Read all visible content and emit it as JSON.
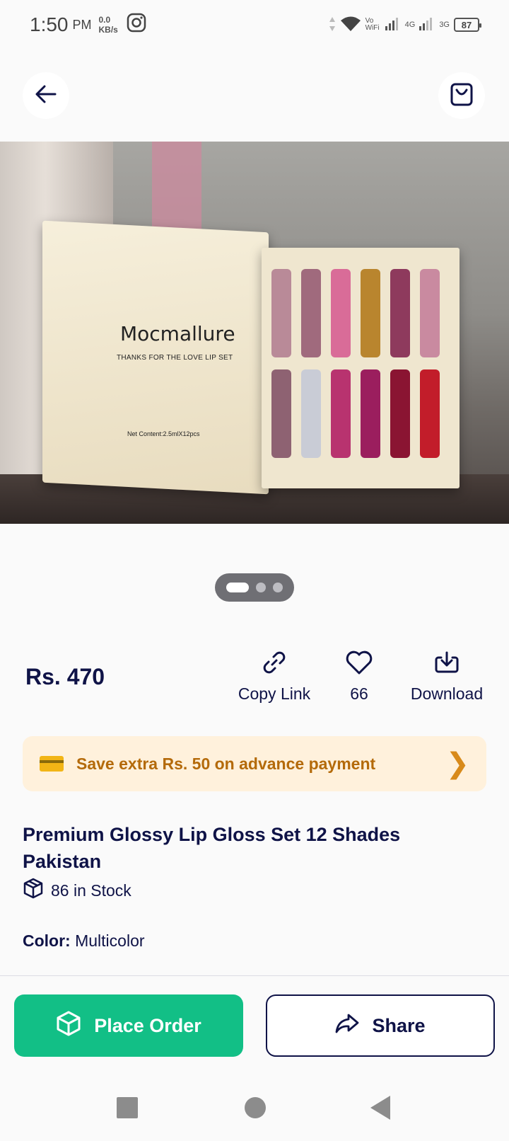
{
  "status_bar": {
    "time": "1:50",
    "ampm": "PM",
    "speed_value": "0.0",
    "speed_unit": "KB/s",
    "vowifi": "Vo WiFi",
    "net1": "4G",
    "net2": "3G",
    "battery": "87"
  },
  "nav": {
    "back_icon": "arrow-left-icon",
    "cart_icon": "shopping-bag-icon"
  },
  "product_image": {
    "brand_text": "Mocmallure",
    "tagline": "THANKS FOR THE LOVE LIP SET",
    "net_content": "Net Content:2.5mlX12pcs",
    "carousel": {
      "total": 3,
      "active_index": 0
    }
  },
  "price": "Rs. 470",
  "actions": {
    "copy_link": "Copy Link",
    "likes": "66",
    "download": "Download"
  },
  "promo": {
    "text": "Save extra Rs. 50 on advance payment",
    "chevron": "❯"
  },
  "product": {
    "title": "Premium Glossy Lip Gloss Set 12 Shades Pakistan",
    "stock": "86 in Stock",
    "color_label": "Color:",
    "color_value": "Multicolor"
  },
  "buttons": {
    "place_order": "Place Order",
    "share": "Share"
  },
  "colors": {
    "primary": "#0f1347",
    "order_green": "#12bf86",
    "promo_bg": "#fff1dc",
    "promo_text": "#b46a0a"
  }
}
